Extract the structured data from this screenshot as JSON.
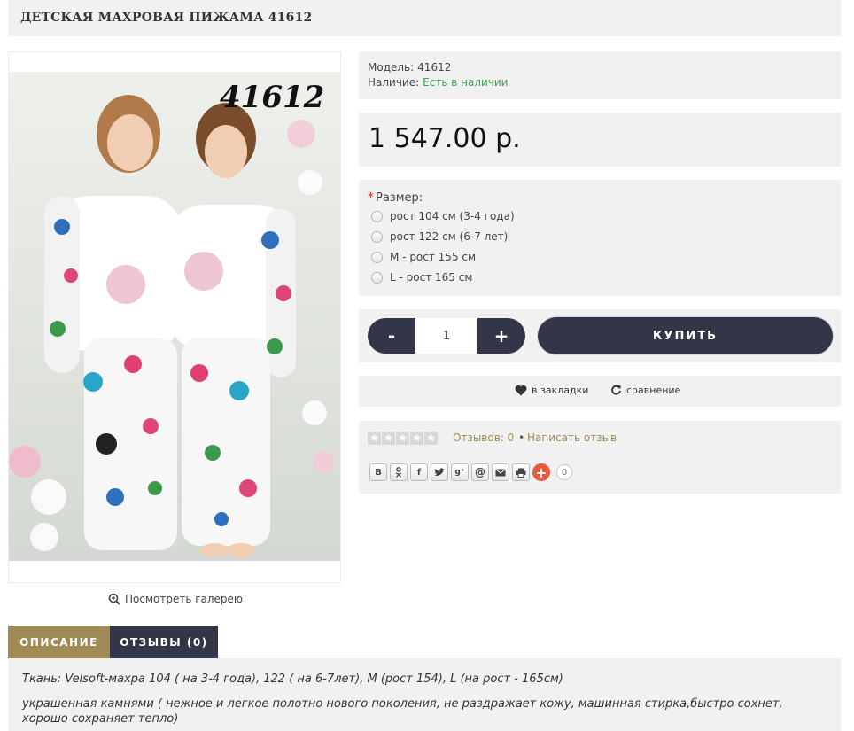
{
  "product": {
    "title": "ДЕТСКАЯ МАХРОВАЯ ПИЖАМА 41612",
    "image_number": "41612",
    "gallery_link": "Посмотреть галерею"
  },
  "info": {
    "model_label": "Модель:",
    "model_value": "41612",
    "stock_label": "Наличие:",
    "stock_value": "Есть в наличии"
  },
  "price": "1 547.00 р.",
  "options": {
    "required_mark": "*",
    "title": "Размер:",
    "items": [
      "рост 104 см (3-4 года)",
      "рост 122 см (6-7 лет)",
      "M - рост 155 см",
      "L - рост 165 см"
    ]
  },
  "cart": {
    "minus": "-",
    "quantity": "1",
    "plus": "+",
    "buy_label": "КУПИТЬ"
  },
  "links": {
    "wishlist": "в закладки",
    "compare": "сравнение"
  },
  "rating": {
    "stars": 0,
    "reviews": "Отзывов: 0",
    "separator": "•",
    "write": "Написать отзыв"
  },
  "share": {
    "buttons": [
      "B",
      "ok",
      "f",
      "tw",
      "g+",
      "@",
      "mail",
      "print"
    ],
    "count": "0"
  },
  "tabs": {
    "description": "ОПИСАНИЕ",
    "reviews": "ОТЗЫВЫ (0)"
  },
  "description": {
    "line1": "Ткань: Velsoft-махра 104 ( на 3-4 года), 122 ( на 6-7лет),  M (рост 154),  L (на рост - 165см)",
    "line2": "украшенная камнями ( нежное и легкое полотно нового поколения, не раздражает кожу, машинная стирка,быстро сохнет, хорошо сохраняет тепло)"
  },
  "colors": {
    "panel_bg": "#f1f1f1",
    "dark_button": "#333646",
    "accent_gold": "#a08a55",
    "stock_green": "#3aa64c",
    "required_red": "#d9241c"
  }
}
